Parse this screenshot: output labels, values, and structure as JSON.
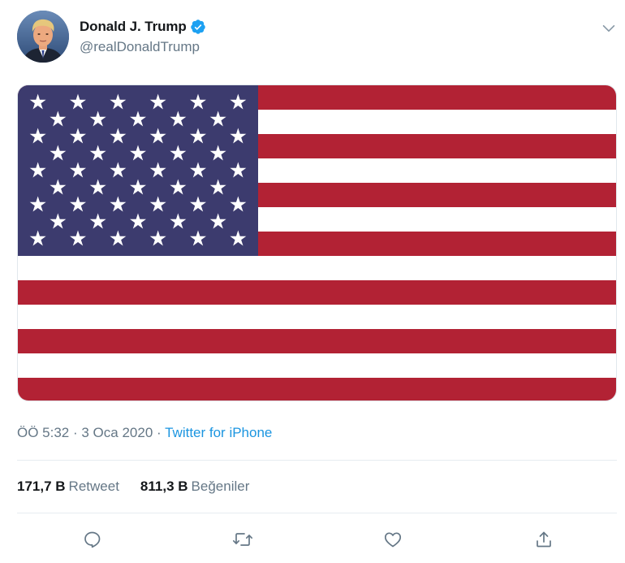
{
  "author": {
    "display_name": "Donald J. Trump",
    "handle": "@realDonaldTrump",
    "verified": true
  },
  "media": {
    "type": "image",
    "depicts": "flag-of-the-united-states",
    "stars": 50,
    "stripes": 13
  },
  "meta": {
    "time": "ÖÖ 5:32",
    "separator1": " · ",
    "date": "3 Oca 2020",
    "separator2": " · ",
    "source": "Twitter for iPhone"
  },
  "stats": {
    "retweets_count": "171,7 B",
    "retweets_label": "Retweet",
    "likes_count": "811,3 B",
    "likes_label": "Beğeniler"
  },
  "actions": [
    {
      "name": "reply",
      "icon": "reply-icon"
    },
    {
      "name": "retweet",
      "icon": "retweet-icon"
    },
    {
      "name": "like",
      "icon": "heart-icon"
    },
    {
      "name": "share",
      "icon": "share-icon"
    }
  ],
  "colors": {
    "flag_red": "#b22234",
    "flag_blue": "#3c3b6e",
    "verified_blue": "#1da1f2",
    "link_blue": "#1b95e0",
    "muted_gray": "#657786"
  }
}
